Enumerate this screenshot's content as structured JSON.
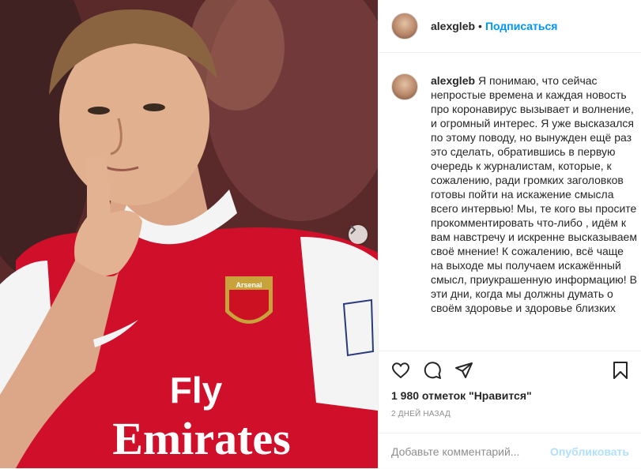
{
  "post": {
    "username": "alexgleb",
    "dot": "•",
    "follow_label": "Подписаться",
    "caption": "Я понимаю, что сейчас непростые времена и каждая новость про коронавирус вызывает и волнение, и огромный интерес. Я уже высказался по этому поводу, но вынужден ещё раз это сделать, обратившись в первую очередь к журналистам, которые, к сожалению, ради громких заголовков готовы пойти на искажение смысла всего интервью! Мы, те кого вы просите прокомментировать что-либо , идём к вам навстречу и искренне высказываем своё мнение! К сожалению, всё чаще на выходе мы получаем искажённый смысл, приукрашенную информацию! В эти дни, когда мы должны думать о своём здоровье и здоровье близких",
    "likes": "1 980 отметок \"Нравится\"",
    "time": "2 ДНЕЙ НАЗАД",
    "comment_placeholder": "Добавьте комментарий...",
    "post_label": "Опубликовать"
  },
  "photo": {
    "shirt_text_1": "Fly",
    "shirt_text_2": "Emirates",
    "badge_text": "Arsenal"
  },
  "icons": {
    "like": "heart-icon",
    "comment": "comment-icon",
    "share": "share-icon",
    "save": "bookmark-icon",
    "next": "chevron-right-icon"
  },
  "colors": {
    "accent": "#0095f6",
    "post_disabled": "#b2dffc",
    "shirt_red": "#d0102a"
  }
}
